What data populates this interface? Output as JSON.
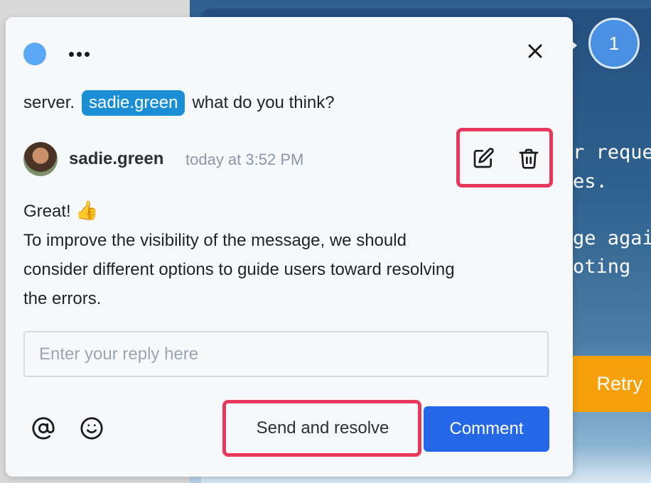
{
  "background": {
    "text_lines": [
      "r reque",
      "es.",
      "ge agai",
      "oting"
    ],
    "retry_label": "Retry",
    "counter_badge": "1"
  },
  "popover": {
    "previous_message": {
      "prefix": "server.",
      "mention": "sadie.green",
      "suffix": "what do you think?"
    },
    "comment": {
      "author": "sadie.green",
      "timestamp": "today at 3:52 PM",
      "line1": "Great!",
      "emoji": "👍",
      "body_lines": [
        "To improve the visibility of the message, we should",
        "consider different options to guide users toward resolving",
        "the errors."
      ]
    },
    "reply": {
      "placeholder": "Enter your reply here",
      "value": ""
    },
    "buttons": {
      "send_and_resolve": "Send and resolve",
      "comment": "Comment"
    }
  },
  "icons": {
    "status": "status-dot-icon",
    "more": "more-horizontal-icon",
    "close": "close-icon",
    "edit": "edit-icon",
    "delete": "trash-icon",
    "mention": "at-sign-icon",
    "emoji": "smiley-icon"
  },
  "colors": {
    "highlight": "#e8395d",
    "primary": "#2468e8",
    "mention_bg": "#1b8fd6",
    "retry": "#f6a10b"
  }
}
